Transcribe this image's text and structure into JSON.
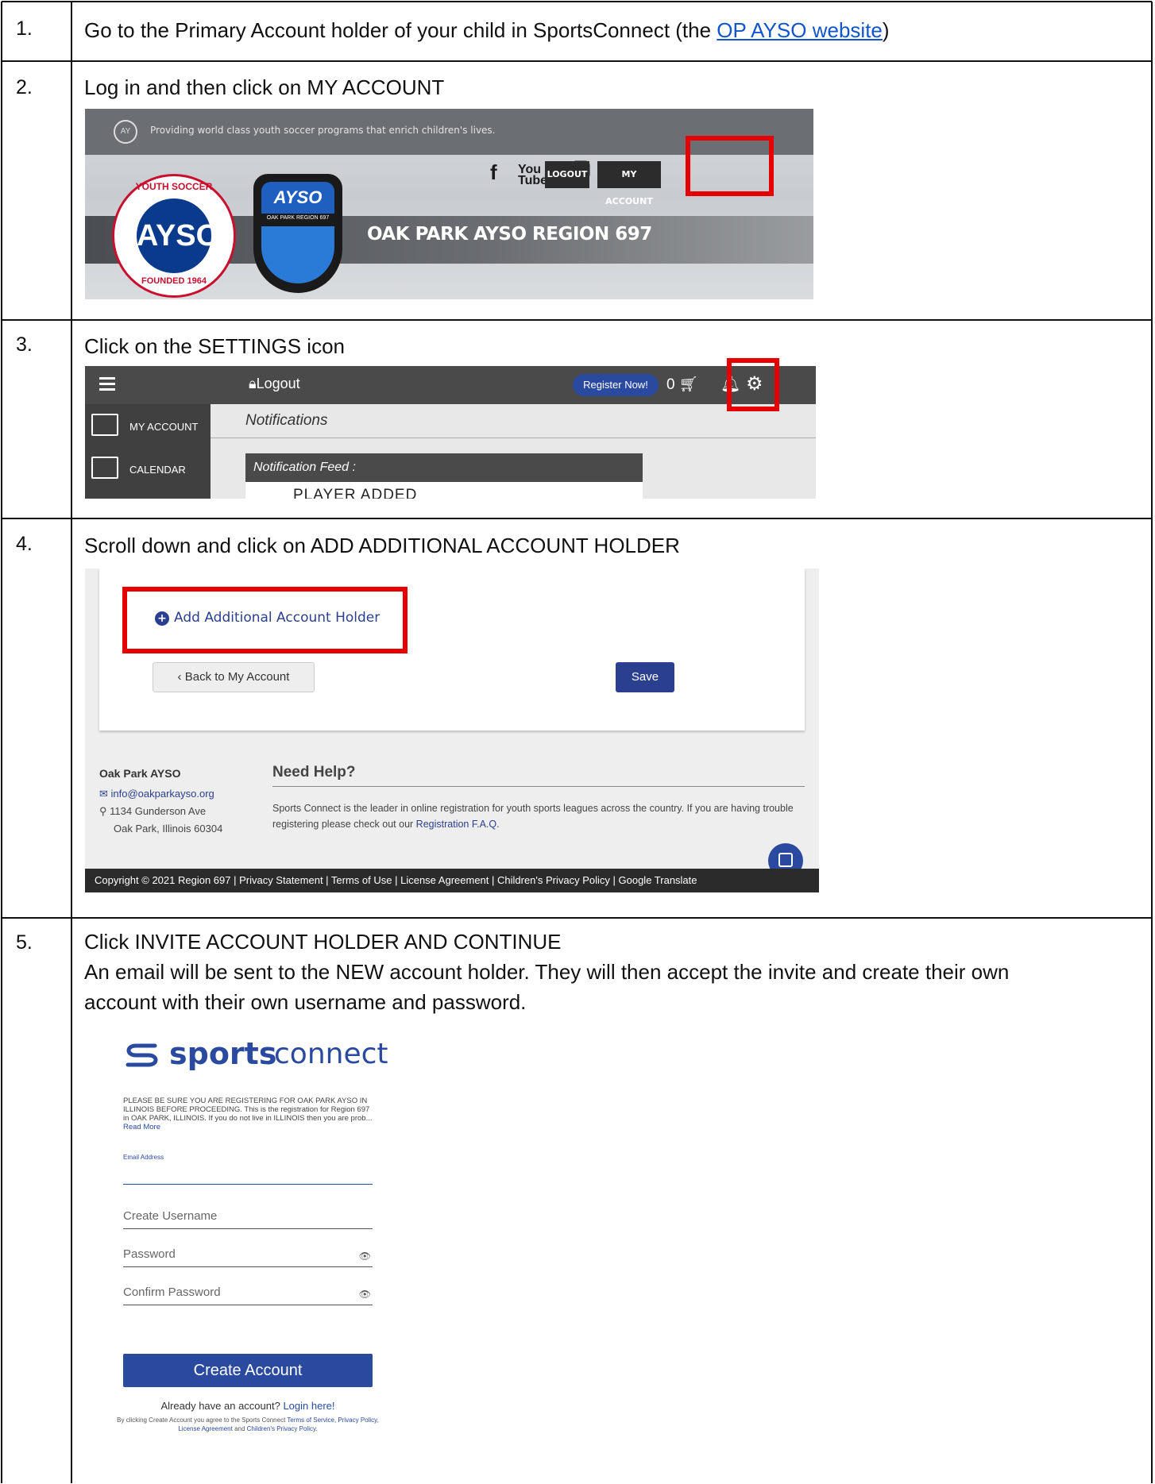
{
  "steps": [
    {
      "num": "1.",
      "text_before": "Go to the Primary Account holder of your child in SportsConnect (the ",
      "link": "OP AYSO website",
      "text_after": ")"
    },
    {
      "num": "2.",
      "text": "Log in and then click on MY ACCOUNT"
    },
    {
      "num": "3.",
      "text": "Click on the SETTINGS icon"
    },
    {
      "num": "4.",
      "text": "Scroll down and click on ADD ADDITIONAL ACCOUNT HOLDER"
    },
    {
      "num": "5.",
      "line1": "Click INVITE ACCOUNT HOLDER AND CONTINUE",
      "line2": "An email will be sent to the NEW account holder. They will then accept the invite and create their own",
      "line3": "account with their own username and password."
    }
  ],
  "shot1": {
    "tagline": "Providing world class youth soccer programs that enrich children's lives.",
    "logout": "LOGOUT",
    "my_account": "MY ACCOUNT",
    "region": "OAK PARK AYSO REGION 697",
    "badge_center": "AYSO",
    "badge_top": "YOUTH SOCCER",
    "badge_bottom": "FOUNDED 1964",
    "shield_top": "AYSO",
    "shield_mid": "OAK PARK REGION 697",
    "icons": [
      "facebook-icon",
      "youtube-icon",
      "twitter-icon",
      "instagram-icon",
      "translate-icon"
    ]
  },
  "shot2": {
    "logout": "Logout",
    "register": "Register Now!",
    "cart_count": "0",
    "sidebar": [
      "MY ACCOUNT",
      "CALENDAR"
    ],
    "notifications": "Notifications",
    "feed": "Notification Feed :",
    "feed_item": "PLAYER ADDED"
  },
  "shot3": {
    "add_holder": "Add Additional Account Holder",
    "back": "Back to My Account",
    "save": "Save",
    "org": "Oak Park AYSO",
    "email": "info@oakparkayso.org",
    "address1": "1134 Gunderson Ave",
    "address2": "Oak Park, Illinois 60304",
    "need_help": "Need Help?",
    "help_text": "Sports Connect is the leader in online registration for youth sports leagues across the country. If you are having trouble registering please check out our ",
    "help_link": "Registration F.A.Q.",
    "footer": "Copyright © 2021 Region 697   |  Privacy Statement   |  Terms of Use   |  License Agreement   |  Children's Privacy Policy   |  Google Translate"
  },
  "shot4": {
    "logo_bold": "sports",
    "logo_light": "connect",
    "notice": "PLEASE BE SURE YOU ARE REGISTERING FOR OAK PARK AYSO IN ILLINOIS BEFORE PROCEEDING. This is the registration for Region 697 in OAK PARK, ILLINOIS. If you do not live in ILLINOIS then you are prob... ",
    "read_more": "Read More",
    "email_label": "Email Address",
    "username": "Create Username",
    "password": "Password",
    "confirm": "Confirm Password",
    "create": "Create Account",
    "already": "Already have an account? ",
    "login": "Login here!",
    "terms_prefix": "By clicking Create Account you agree to the Sports Connect ",
    "terms_links": "Terms of Service, Privacy Policy, License Agreement",
    "terms_and": " and ",
    "terms_last": "Children's Privacy Policy."
  }
}
